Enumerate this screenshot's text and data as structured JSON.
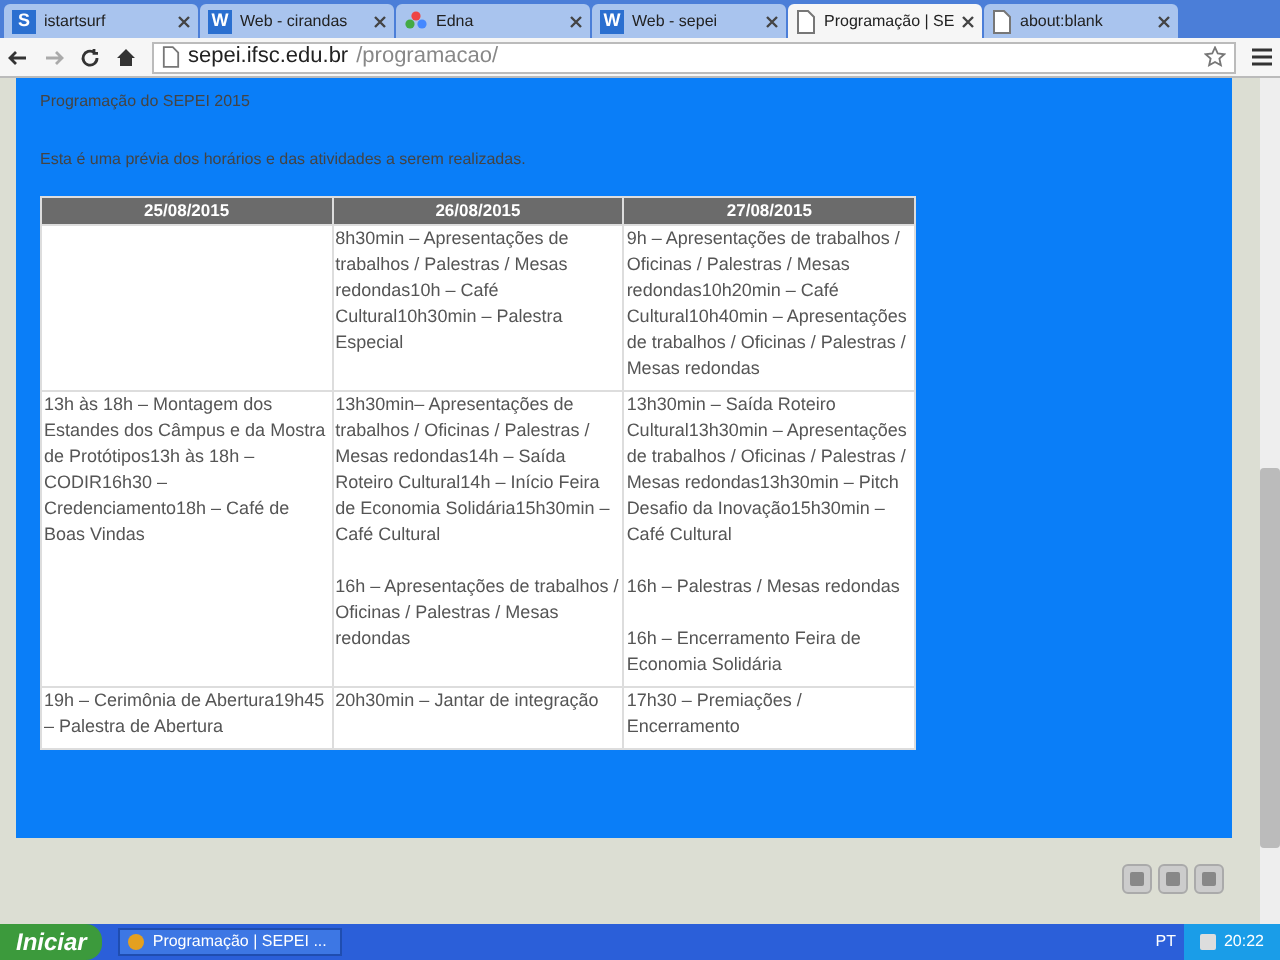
{
  "browser": {
    "tabs": [
      {
        "label": "istartsurf",
        "kind": "letter",
        "logo_letter": "S",
        "selected": false
      },
      {
        "label": "Web - cirandas",
        "kind": "letter",
        "logo_letter": "W",
        "selected": false
      },
      {
        "label": "Edna",
        "kind": "flower",
        "selected": false
      },
      {
        "label": "Web - sepei",
        "kind": "letter",
        "logo_letter": "W",
        "selected": false
      },
      {
        "label": "Programação | SE",
        "kind": "page",
        "selected": true
      },
      {
        "label": "about:blank",
        "kind": "page",
        "selected": false
      }
    ],
    "url_host": "sepei.ifsc.edu.br",
    "url_path": "/programacao/"
  },
  "page": {
    "heading": "Programação do SEPEI 2015",
    "intro": "Esta é uma prévia dos horários e das atividades a serem realizadas.",
    "table": {
      "columns": [
        "25/08/2015",
        "26/08/2015",
        "27/08/2015"
      ],
      "rows": [
        [
          [],
          [
            "8h30min – Apresentações de trabalhos / Palestras / Mesas redondas10h – Café Cultural10h30min – Palestra Especial"
          ],
          [
            "9h – Apresentações de trabalhos / Oficinas / Palestras /  Mesas redondas10h20min – Café Cultural10h40min – Apresentações de trabalhos / Oficinas / Palestras / Mesas redondas"
          ]
        ],
        [
          [
            "13h às 18h – Montagem dos Estandes dos Câmpus e da Mostra de Protótipos13h às 18h – CODIR16h30 – Credenciamento18h – Café de Boas Vindas"
          ],
          [
            "13h30min– Apresentações de trabalhos / Oficinas / Palestras / Mesas redondas14h – Saída Roteiro Cultural14h – Início Feira de Economia Solidária15h30min – Café Cultural",
            "16h – Apresentações de trabalhos / Oficinas / Palestras / Mesas redondas"
          ],
          [
            "13h30min – Saída Roteiro Cultural13h30min – Apresentações de trabalhos / Oficinas / Palestras / Mesas redondas13h30min – Pitch Desafio da Inovação15h30min – Café Cultural",
            "16h – Palestras / Mesas redondas",
            "16h – Encerramento Feira de Economia Solidária"
          ]
        ],
        [
          [
            "19h – Cerimônia de Abertura19h45 – Palestra de Abertura"
          ],
          [
            "20h30min – Jantar de integração"
          ],
          [
            "17h30 – Premiações / Encerramento"
          ]
        ]
      ]
    }
  },
  "taskbar": {
    "start": "Iniciar",
    "window": "Programação | SEPEI ...",
    "lang": "PT",
    "clock": "20:22"
  }
}
